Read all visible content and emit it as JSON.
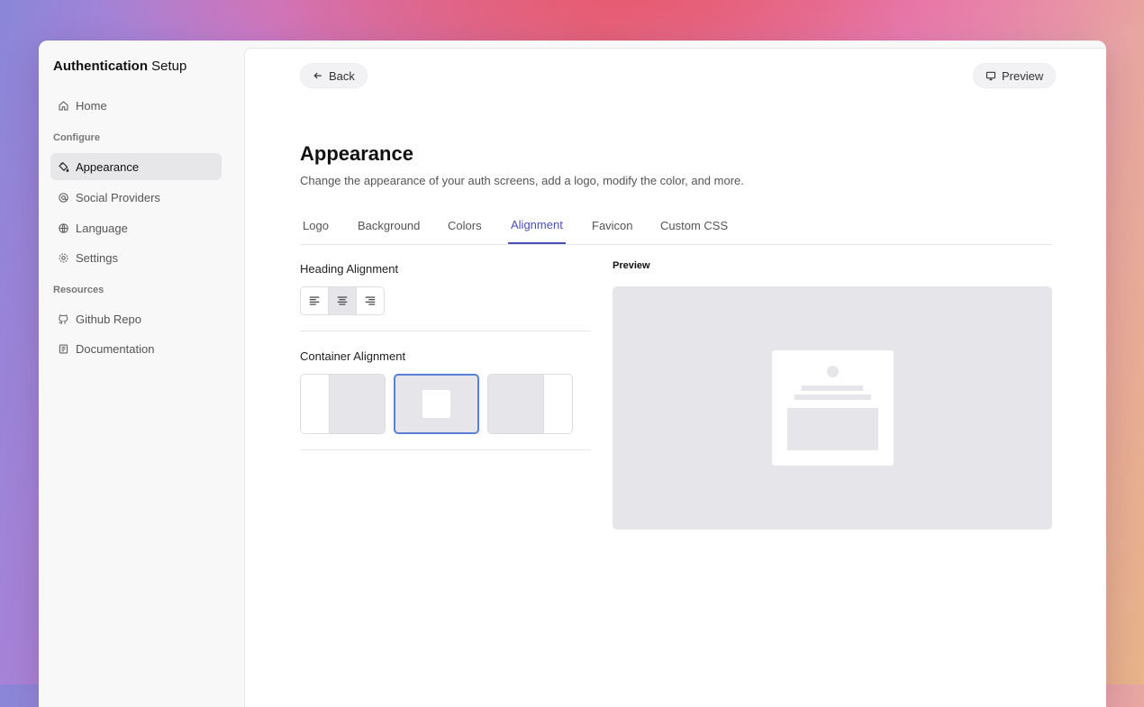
{
  "app": {
    "title_bold": "Authentication",
    "title_rest": "Setup"
  },
  "sidebar": {
    "home": "Home",
    "configure_label": "Configure",
    "configure_items": [
      "Appearance",
      "Social Providers",
      "Language",
      "Settings"
    ],
    "resources_label": "Resources",
    "resources_items": [
      "Github Repo",
      "Documentation"
    ]
  },
  "toolbar": {
    "back_label": "Back",
    "preview_label": "Preview"
  },
  "page": {
    "title": "Appearance",
    "subtitle": "Change the appearance of your auth screens, add a logo, modify the color, and more."
  },
  "tabs": [
    "Logo",
    "Background",
    "Colors",
    "Alignment",
    "Favicon",
    "Custom CSS"
  ],
  "active_tab": "Alignment",
  "heading_alignment": {
    "label": "Heading Alignment",
    "options": [
      "left",
      "center",
      "right"
    ],
    "selected": "center"
  },
  "container_alignment": {
    "label": "Container Alignment",
    "options": [
      "left",
      "center",
      "right"
    ],
    "selected": "center"
  },
  "preview": {
    "label": "Preview"
  },
  "colors": {
    "accent": "#4a4fb8",
    "selected_border": "#5b7fd6"
  }
}
